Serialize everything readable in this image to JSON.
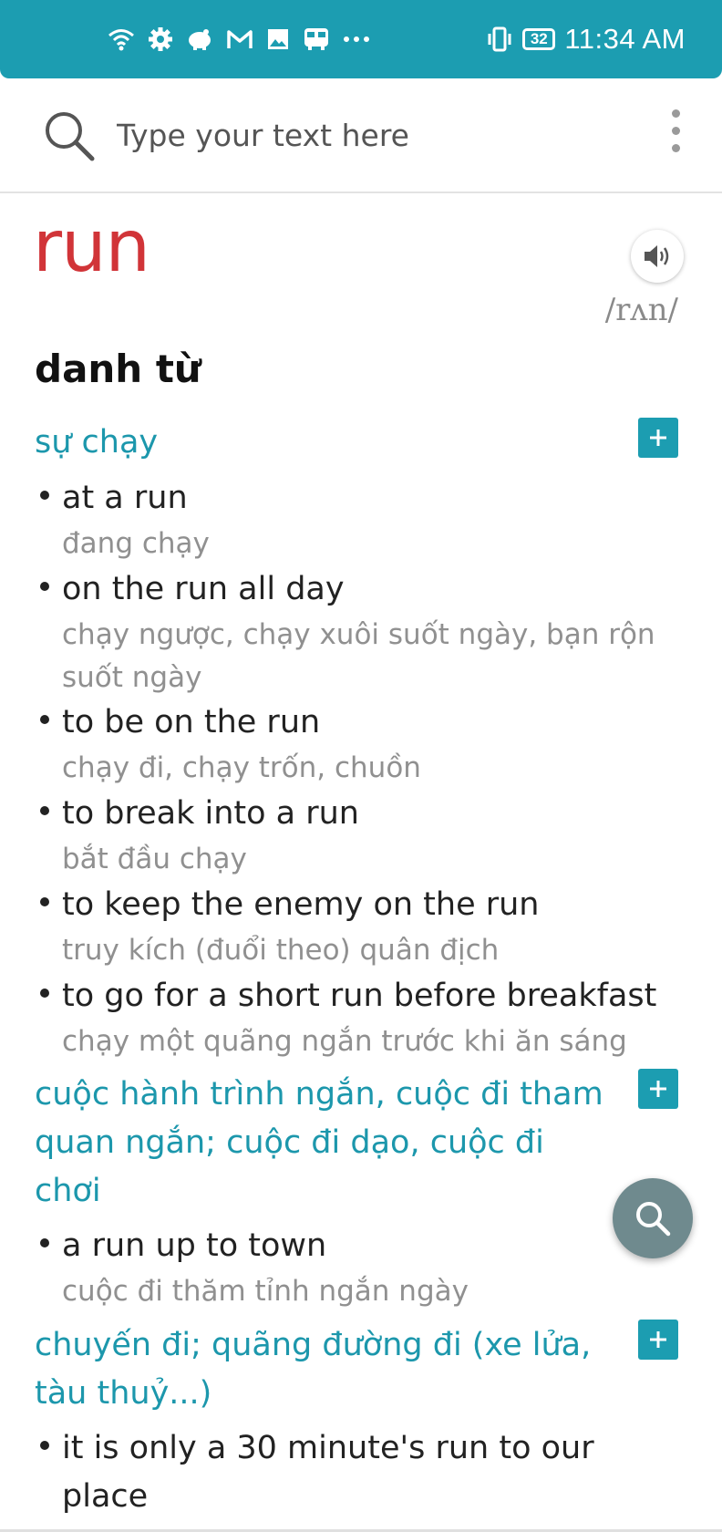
{
  "status_bar": {
    "time": "11:34 AM",
    "battery": "32",
    "icons": [
      "wifi-icon",
      "settings-icon",
      "piggy-bank-icon",
      "gmail-icon",
      "gallery-icon",
      "bus-icon",
      "more-dots-icon",
      "vibrate-icon",
      "battery-icon"
    ]
  },
  "search": {
    "placeholder": "Type your text here"
  },
  "entry": {
    "word": "run",
    "phonetic": "/rʌn/",
    "part_of_speech": "danh từ",
    "senses": [
      {
        "title": "sự chạy",
        "examples": [
          {
            "en": "at a run",
            "vi": "đang chạy"
          },
          {
            "en": "on the run all day",
            "vi": "chạy ngược, chạy xuôi suốt ngày, bạn rộn suốt ngày"
          },
          {
            "en": "to be on the run",
            "vi": "chạy đi, chạy trốn, chuồn"
          },
          {
            "en": "to break into a run",
            "vi": "bắt đầu chạy"
          },
          {
            "en": "to keep the enemy on the run",
            "vi": "truy kích (đuổi theo) quân địch"
          },
          {
            "en": "to go for a short run before breakfast",
            "vi": "chạy một quãng ngắn trước khi ăn sáng"
          }
        ]
      },
      {
        "title": "cuộc hành trình ngắn, cuộc đi tham quan ngắn; cuộc đi dạo, cuộc đi chơi",
        "examples": [
          {
            "en": "a run up to town",
            "vi": "cuộc đi thăm tỉnh ngắn ngày"
          }
        ]
      },
      {
        "title": "chuyến đi; quãng đường đi (xe lửa, tàu thuỷ...)",
        "examples": [
          {
            "en": "it is only a 30 minute's run to our place",
            "vi": ""
          }
        ]
      }
    ]
  },
  "colors": {
    "accent": "#1c9db1",
    "headword": "#d13438",
    "sense": "#1c97ac",
    "translation": "#909090"
  }
}
